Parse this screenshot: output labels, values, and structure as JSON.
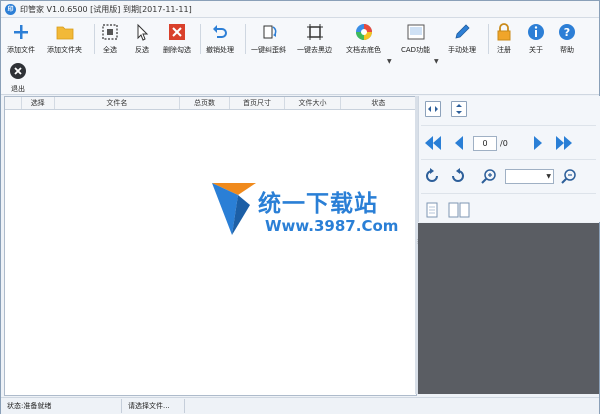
{
  "window": {
    "title": "印管家 V1.0.6500 [试用版] 到期[2017-11-11]",
    "app_icon": "印"
  },
  "toolbar": {
    "add_file": "添加文件",
    "add_folder": "添加文件夹",
    "select_all": "全选",
    "invert_select": "反选",
    "delete_checked": "删除勾选",
    "undo": "撤销处理",
    "deskew": "一键纠歪斜",
    "remove_black_edge": "一键去黑边",
    "doc_color_remove": "文档去底色",
    "cad": "CAD功能",
    "manual": "手动处理",
    "register": "注册",
    "about": "关于",
    "help": "帮助",
    "exit": "退出"
  },
  "table": {
    "columns": [
      "",
      "选择",
      "文件名",
      "总页数",
      "首页尺寸",
      "文件大小",
      "状态"
    ],
    "rows": []
  },
  "viewer": {
    "page_current": "0",
    "page_total": "/0",
    "zoom_value": ""
  },
  "watermark": {
    "line1": "统一下载站",
    "line2": "Www.3987.Com"
  },
  "status": {
    "ready": "状态:准备就绪",
    "hint": "请选择文件..."
  },
  "colors": {
    "accent": "#2d7fd6",
    "danger": "#d9402b",
    "preview_bg": "#5a5d63"
  }
}
